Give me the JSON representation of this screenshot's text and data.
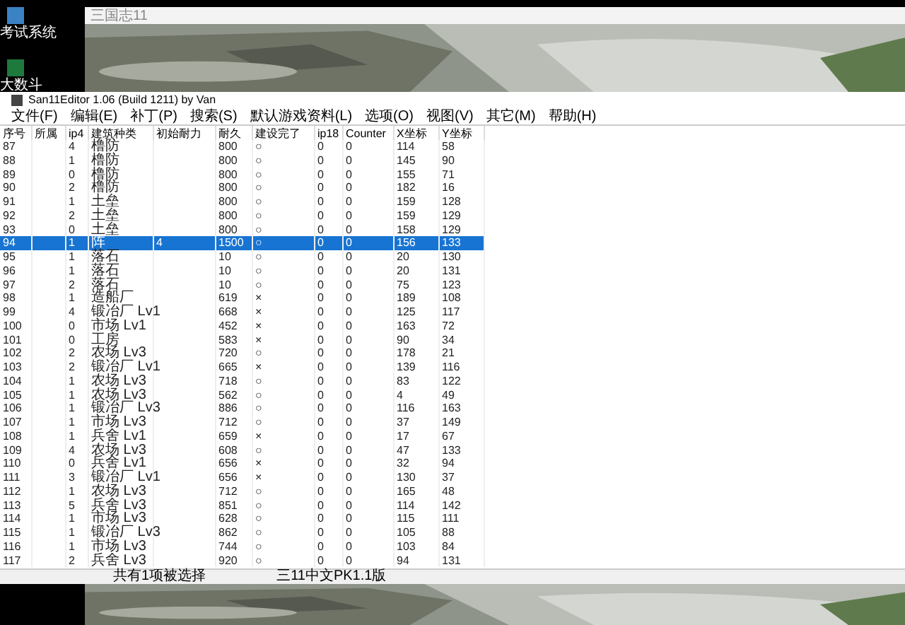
{
  "desktop_icons": [
    {
      "label": "考试系统"
    },
    {
      "label": "大数斗"
    }
  ],
  "game_window": {
    "title": "三国志11"
  },
  "editor": {
    "title": "San11Editor 1.06 (Build 1211) by Van",
    "menu": [
      "文件(F)",
      "编辑(E)",
      "补丁(P)",
      "搜索(S)",
      "默认游戏资料(L)",
      "选项(O)",
      "视图(V)",
      "其它(M)",
      "帮助(H)"
    ],
    "table": {
      "columns": [
        "序号",
        "所属",
        "ip4",
        "建筑种类",
        "初始耐力",
        "耐久",
        "建设完了",
        "ip18",
        "Counter",
        "X坐标",
        "Y坐标"
      ],
      "rows": [
        {
          "selected": false,
          "cells": [
            "87",
            "",
            "4",
            "橹防",
            "",
            "800",
            "○",
            "0",
            "0",
            "114",
            "58"
          ]
        },
        {
          "selected": false,
          "cells": [
            "88",
            "",
            "1",
            "橹防",
            "",
            "800",
            "○",
            "0",
            "0",
            "145",
            "90"
          ]
        },
        {
          "selected": false,
          "cells": [
            "89",
            "",
            "0",
            "橹防",
            "",
            "800",
            "○",
            "0",
            "0",
            "155",
            "71"
          ]
        },
        {
          "selected": false,
          "cells": [
            "90",
            "",
            "2",
            "橹防",
            "",
            "800",
            "○",
            "0",
            "0",
            "182",
            "16"
          ]
        },
        {
          "selected": false,
          "cells": [
            "91",
            "",
            "1",
            "土垒",
            "",
            "800",
            "○",
            "0",
            "0",
            "159",
            "128"
          ]
        },
        {
          "selected": false,
          "cells": [
            "92",
            "",
            "2",
            "土垒",
            "",
            "800",
            "○",
            "0",
            "0",
            "159",
            "129"
          ]
        },
        {
          "selected": false,
          "cells": [
            "93",
            "",
            "0",
            "土垒",
            "",
            "800",
            "○",
            "0",
            "0",
            "158",
            "129"
          ]
        },
        {
          "selected": true,
          "cells": [
            "94",
            "",
            "1",
            "阵",
            "4",
            "1500",
            "○",
            "0",
            "0",
            "156",
            "133"
          ]
        },
        {
          "selected": false,
          "cells": [
            "95",
            "",
            "1",
            "落石",
            "",
            "10",
            "○",
            "0",
            "0",
            "20",
            "130"
          ]
        },
        {
          "selected": false,
          "cells": [
            "96",
            "",
            "1",
            "落石",
            "",
            "10",
            "○",
            "0",
            "0",
            "20",
            "131"
          ]
        },
        {
          "selected": false,
          "cells": [
            "97",
            "",
            "2",
            "落石",
            "",
            "10",
            "○",
            "0",
            "0",
            "75",
            "123"
          ]
        },
        {
          "selected": false,
          "cells": [
            "98",
            "",
            "1",
            "造船厂",
            "",
            "619",
            "×",
            "0",
            "0",
            "189",
            "108"
          ]
        },
        {
          "selected": false,
          "cells": [
            "99",
            "",
            "4",
            "锻冶厂 Lv1",
            "",
            "668",
            "×",
            "0",
            "0",
            "125",
            "117"
          ]
        },
        {
          "selected": false,
          "cells": [
            "100",
            "",
            "0",
            "市场 Lv1",
            "",
            "452",
            "×",
            "0",
            "0",
            "163",
            "72"
          ]
        },
        {
          "selected": false,
          "cells": [
            "101",
            "",
            "0",
            "工房",
            "",
            "583",
            "×",
            "0",
            "0",
            "90",
            "34"
          ]
        },
        {
          "selected": false,
          "cells": [
            "102",
            "",
            "2",
            "农场 Lv3",
            "",
            "720",
            "○",
            "0",
            "0",
            "178",
            "21"
          ]
        },
        {
          "selected": false,
          "cells": [
            "103",
            "",
            "2",
            "锻冶厂 Lv1",
            "",
            "665",
            "×",
            "0",
            "0",
            "139",
            "116"
          ]
        },
        {
          "selected": false,
          "cells": [
            "104",
            "",
            "1",
            "农场 Lv3",
            "",
            "718",
            "○",
            "0",
            "0",
            "83",
            "122"
          ]
        },
        {
          "selected": false,
          "cells": [
            "105",
            "",
            "1",
            "农场 Lv3",
            "",
            "562",
            "○",
            "0",
            "0",
            "4",
            "49"
          ]
        },
        {
          "selected": false,
          "cells": [
            "106",
            "",
            "1",
            "锻冶厂 Lv3",
            "",
            "886",
            "○",
            "0",
            "0",
            "116",
            "163"
          ]
        },
        {
          "selected": false,
          "cells": [
            "107",
            "",
            "1",
            "市场 Lv3",
            "",
            "712",
            "○",
            "0",
            "0",
            "37",
            "149"
          ]
        },
        {
          "selected": false,
          "cells": [
            "108",
            "",
            "1",
            "兵舍 Lv1",
            "",
            "659",
            "×",
            "0",
            "0",
            "17",
            "67"
          ]
        },
        {
          "selected": false,
          "cells": [
            "109",
            "",
            "4",
            "农场 Lv3",
            "",
            "608",
            "○",
            "0",
            "0",
            "47",
            "133"
          ]
        },
        {
          "selected": false,
          "cells": [
            "110",
            "",
            "0",
            "兵舍 Lv1",
            "",
            "656",
            "×",
            "0",
            "0",
            "32",
            "94"
          ]
        },
        {
          "selected": false,
          "cells": [
            "111",
            "",
            "3",
            "锻冶厂 Lv1",
            "",
            "656",
            "×",
            "0",
            "0",
            "130",
            "37"
          ]
        },
        {
          "selected": false,
          "cells": [
            "112",
            "",
            "1",
            "农场 Lv3",
            "",
            "712",
            "○",
            "0",
            "0",
            "165",
            "48"
          ]
        },
        {
          "selected": false,
          "cells": [
            "113",
            "",
            "5",
            "兵舍 Lv3",
            "",
            "851",
            "○",
            "0",
            "0",
            "114",
            "142"
          ]
        },
        {
          "selected": false,
          "cells": [
            "114",
            "",
            "1",
            "市场 Lv3",
            "",
            "628",
            "○",
            "0",
            "0",
            "115",
            "111"
          ]
        },
        {
          "selected": false,
          "cells": [
            "115",
            "",
            "1",
            "锻冶厂 Lv3",
            "",
            "862",
            "○",
            "0",
            "0",
            "105",
            "88"
          ]
        },
        {
          "selected": false,
          "cells": [
            "116",
            "",
            "1",
            "市场 Lv3",
            "",
            "744",
            "○",
            "0",
            "0",
            "103",
            "84"
          ]
        },
        {
          "selected": false,
          "cells": [
            "117",
            "",
            "2",
            "兵舍 Lv3",
            "",
            "920",
            "○",
            "0",
            "0",
            "94",
            "131"
          ]
        }
      ]
    },
    "status_bar": [
      "共有1项被选择",
      "三11中文PK1.1版"
    ]
  }
}
